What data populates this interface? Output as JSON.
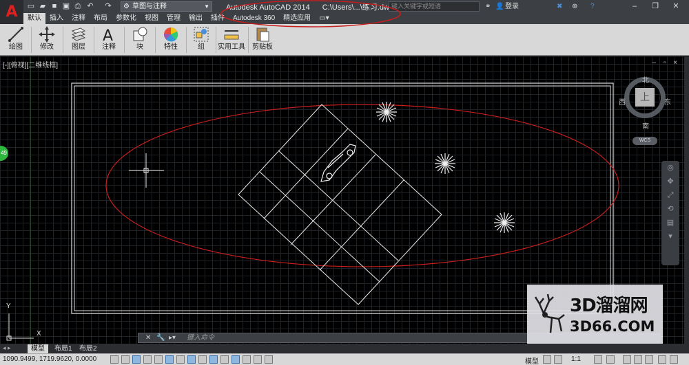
{
  "app": {
    "logo_letter": "A",
    "workspace": "草图与注释",
    "title": "Autodesk AutoCAD 2014",
    "file_path": "C:\\Users\\...\\练习.dwg",
    "search_placeholder": "键入关键字或短语",
    "login_label": "登录"
  },
  "tabs": [
    {
      "label": "默认",
      "active": true
    },
    {
      "label": "插入"
    },
    {
      "label": "注释"
    },
    {
      "label": "布局"
    },
    {
      "label": "参数化"
    },
    {
      "label": "视图"
    },
    {
      "label": "管理"
    },
    {
      "label": "输出"
    },
    {
      "label": "插件"
    },
    {
      "label": "Autodesk 360"
    },
    {
      "label": "精选应用"
    }
  ],
  "ribbon": {
    "draw": "绘图",
    "modify": "修改",
    "layers": "图层",
    "annotation": "注释",
    "block": "块",
    "properties": "特性",
    "groups": "组",
    "utilities": "实用工具",
    "clipboard": "剪贴板"
  },
  "viewport": {
    "label": "[-][俯视][二维线框]",
    "controls": "– ▫ ×"
  },
  "viewcube": {
    "top_face": "上",
    "north": "北",
    "south": "南",
    "east": "东",
    "west": "西",
    "wcs": "WCS"
  },
  "side_badge": "49",
  "command_line": {
    "placeholder": "键入命令"
  },
  "ucs": {
    "x": "X",
    "y": "Y"
  },
  "layout_tabs": [
    {
      "label": "模型",
      "active": true
    },
    {
      "label": "布局1"
    },
    {
      "label": "布局2"
    }
  ],
  "status": {
    "coordinates": "1090.9499, 1719.9620, 0.0000",
    "model": "模型",
    "scale": "1:1"
  },
  "watermark": {
    "line1": "3D溜溜网",
    "line2": "3D66.COM"
  },
  "colors": {
    "accent_red": "#e02020",
    "drawing_line": "#ffffff",
    "ellipse": "#c81e1e"
  }
}
